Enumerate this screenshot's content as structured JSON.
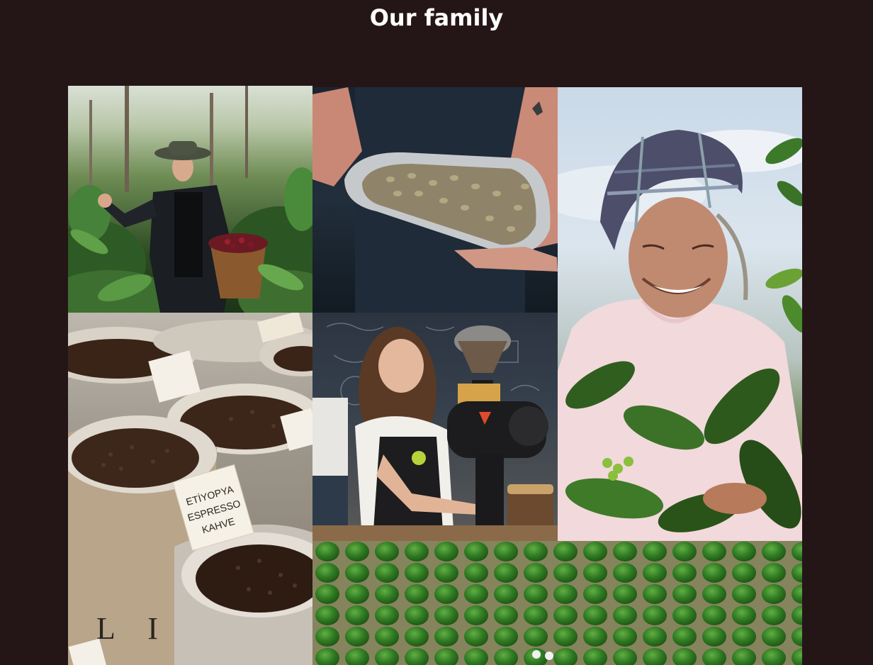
{
  "page": {
    "title": "Our family"
  },
  "gallery": {
    "tiles": [
      {
        "name": "harvester-photo"
      },
      {
        "name": "green-beans-photo"
      },
      {
        "name": "farmer-photo"
      },
      {
        "name": "coffee-sacks-photo"
      },
      {
        "name": "barista-photo"
      },
      {
        "name": "plantation-photo"
      }
    ],
    "sack_sign": {
      "line1": "ETİYOPYA",
      "line2": "ESPRESSO",
      "line3": "KAHVE"
    },
    "sack_print": "L I"
  },
  "colors": {
    "background": "#241617",
    "title": "#ffffff"
  }
}
